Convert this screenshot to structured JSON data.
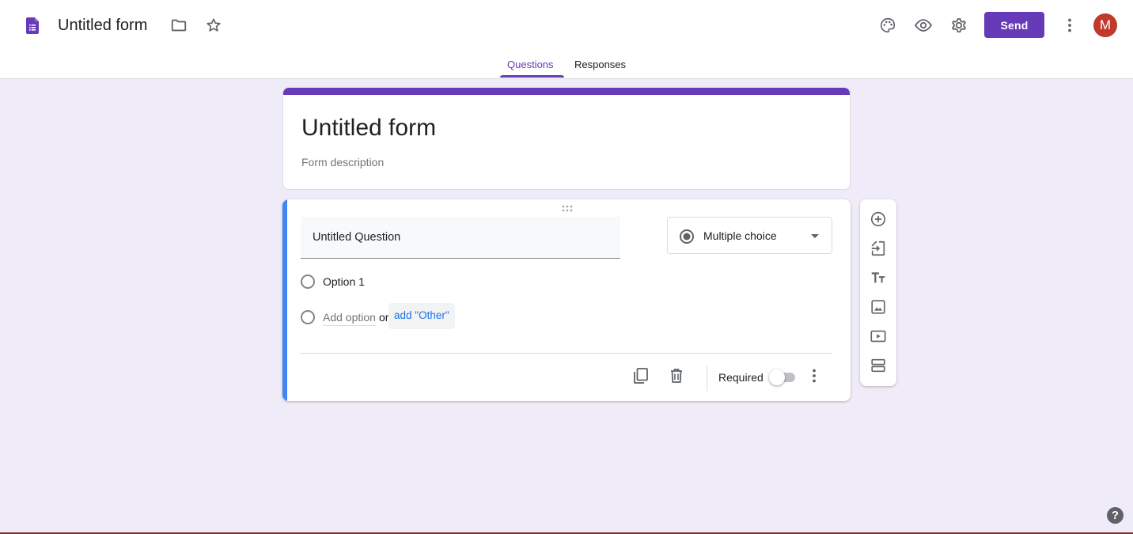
{
  "header": {
    "doc_title": "Untitled form",
    "send_label": "Send",
    "avatar_initial": "M",
    "icons": [
      "forms-app-icon",
      "folder-icon",
      "star-icon",
      "palette-icon",
      "eye-icon",
      "gear-icon",
      "more-vert-icon"
    ]
  },
  "tabs": [
    {
      "label": "Questions",
      "active": true
    },
    {
      "label": "Responses",
      "active": false
    }
  ],
  "form": {
    "title": "Untitled form",
    "description_placeholder": "Form description"
  },
  "question": {
    "title": "Untitled Question",
    "type": "Multiple choice",
    "options": [
      "Option 1"
    ],
    "add_option_placeholder": "Add option",
    "or_text": "or",
    "add_other_label": "add \"Other\"",
    "required_label": "Required",
    "required": false
  },
  "side_toolbar": [
    "add-question-icon",
    "import-questions-icon",
    "add-title-icon",
    "add-image-icon",
    "add-video-icon",
    "add-section-icon"
  ],
  "help_label": "?",
  "colors": {
    "accent": "#673ab7",
    "background": "#f0ebf8",
    "question_focus": "#4285f4",
    "link": "#1a73e8",
    "avatar": "#c0392b"
  }
}
